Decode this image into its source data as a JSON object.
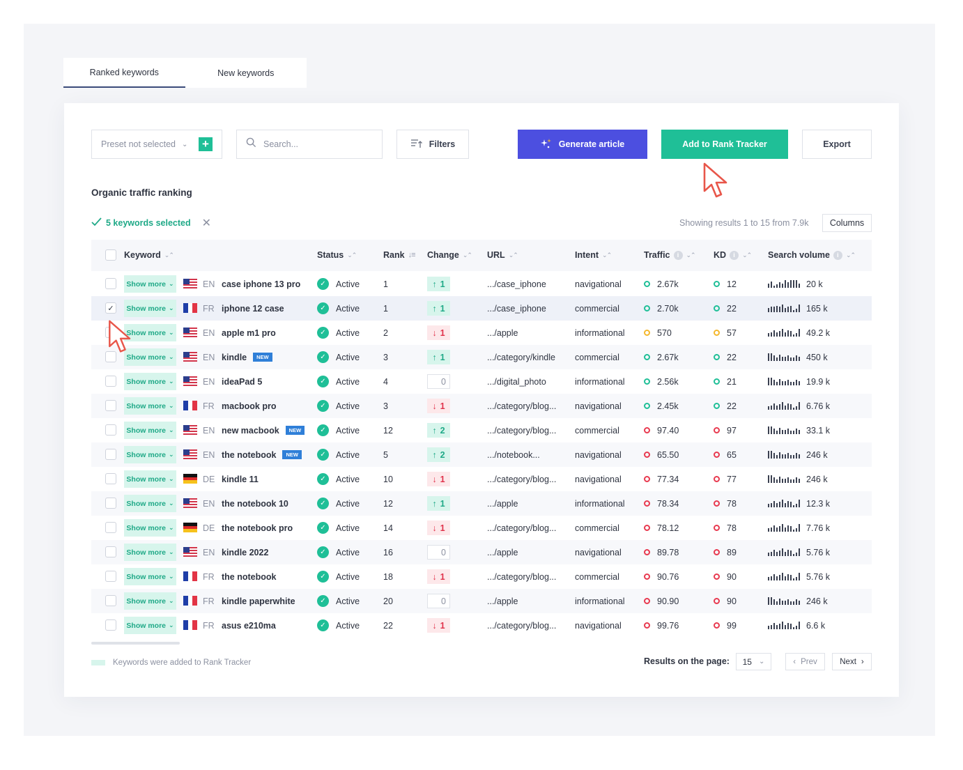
{
  "tabs": [
    {
      "label": "Ranked keywords",
      "active": true
    },
    {
      "label": "New keywords",
      "active": false
    }
  ],
  "toolbar": {
    "preset_label": "Preset not selected",
    "search_placeholder": "Search...",
    "filters_label": "Filters",
    "generate_label": "Generate article",
    "add_tracker_label": "Add to Rank Tracker",
    "export_label": "Export"
  },
  "section_title": "Organic traffic ranking",
  "selection": {
    "label": "5 keywords selected"
  },
  "showing_text": "Showing results 1 to 15 from 7.9k",
  "columns_label": "Columns",
  "headers": {
    "keyword": "Keyword",
    "status": "Status",
    "rank": "Rank",
    "change": "Change",
    "url": "URL",
    "intent": "Intent",
    "traffic": "Traffic",
    "kd": "KD",
    "search_volume": "Search volume"
  },
  "show_more_label": "Show more",
  "new_badge": "NEW",
  "rows": [
    {
      "checked": false,
      "country": "us",
      "lang": "EN",
      "keyword": "case iphone 13 pro",
      "new": false,
      "status": "Active",
      "rank": "1",
      "change_dir": "up",
      "change": "1",
      "url": ".../case_iphone",
      "intent": "navigational",
      "level": "green",
      "traffic": "2.67k",
      "kd": "12",
      "spark": [
        4,
        6,
        2,
        3,
        5,
        4,
        7,
        5,
        7,
        7,
        7,
        4
      ],
      "volume": "20 k"
    },
    {
      "checked": true,
      "country": "fr",
      "lang": "FR",
      "keyword": "iphone 12 case",
      "new": false,
      "status": "Active",
      "rank": "1",
      "change_dir": "up",
      "change": "1",
      "url": ".../case_iphone",
      "intent": "commercial",
      "level": "green",
      "traffic": "2.70k",
      "kd": "22",
      "spark": [
        4,
        5,
        5,
        6,
        5,
        7,
        4,
        5,
        6,
        2,
        3,
        7
      ],
      "volume": "165 k"
    },
    {
      "checked": false,
      "country": "us",
      "lang": "EN",
      "keyword": "apple m1 pro",
      "new": false,
      "status": "Active",
      "rank": "2",
      "change_dir": "down",
      "change": "1",
      "url": ".../apple",
      "intent": "informational",
      "level": "yellow",
      "traffic": "570",
      "kd": "57",
      "spark": [
        3,
        4,
        6,
        4,
        5,
        7,
        4,
        6,
        5,
        2,
        3,
        7
      ],
      "volume": "49.2 k"
    },
    {
      "checked": false,
      "country": "us",
      "lang": "EN",
      "keyword": "kindle",
      "new": true,
      "status": "Active",
      "rank": "3",
      "change_dir": "up",
      "change": "1",
      "url": ".../category/kindle",
      "intent": "commercial",
      "level": "green",
      "traffic": "2.67k",
      "kd": "22",
      "spark": [
        7,
        7,
        5,
        3,
        6,
        4,
        4,
        5,
        3,
        3,
        5,
        4
      ],
      "volume": "450 k"
    },
    {
      "checked": false,
      "country": "us",
      "lang": "EN",
      "keyword": "ideaPad 5",
      "new": false,
      "status": "Active",
      "rank": "4",
      "change_dir": "zero",
      "change": "0",
      "url": ".../digital_photo",
      "intent": "informational",
      "level": "green",
      "traffic": "2.56k",
      "kd": "21",
      "spark": [
        7,
        7,
        5,
        3,
        6,
        4,
        4,
        5,
        3,
        3,
        5,
        4
      ],
      "volume": "19.9 k"
    },
    {
      "checked": false,
      "country": "fr",
      "lang": "FR",
      "keyword": "macbook pro",
      "new": false,
      "status": "Active",
      "rank": "3",
      "change_dir": "down",
      "change": "1",
      "url": ".../category/blog...",
      "intent": "navigational",
      "level": "green",
      "traffic": "2.45k",
      "kd": "22",
      "spark": [
        3,
        4,
        6,
        4,
        5,
        7,
        4,
        6,
        5,
        2,
        3,
        7
      ],
      "volume": "6.76 k"
    },
    {
      "checked": false,
      "country": "us",
      "lang": "EN",
      "keyword": "new macbook",
      "new": true,
      "status": "Active",
      "rank": "12",
      "change_dir": "up",
      "change": "2",
      "url": ".../category/blog...",
      "intent": "commercial",
      "level": "red",
      "traffic": "97.40",
      "kd": "97",
      "spark": [
        7,
        7,
        5,
        3,
        6,
        4,
        4,
        5,
        3,
        3,
        5,
        4
      ],
      "volume": "33.1 k"
    },
    {
      "checked": false,
      "country": "us",
      "lang": "EN",
      "keyword": "the notebook",
      "new": true,
      "status": "Active",
      "rank": "5",
      "change_dir": "up",
      "change": "2",
      "url": ".../notebook...",
      "intent": "navigational",
      "level": "red",
      "traffic": "65.50",
      "kd": "65",
      "spark": [
        7,
        7,
        5,
        3,
        6,
        4,
        4,
        5,
        3,
        3,
        5,
        4
      ],
      "volume": "246 k"
    },
    {
      "checked": false,
      "country": "de",
      "lang": "DE",
      "keyword": "kindle 11",
      "new": false,
      "status": "Active",
      "rank": "10",
      "change_dir": "down",
      "change": "1",
      "url": ".../category/blog...",
      "intent": "navigational",
      "level": "red",
      "traffic": "77.34",
      "kd": "77",
      "spark": [
        7,
        7,
        5,
        3,
        6,
        4,
        4,
        5,
        3,
        3,
        5,
        4
      ],
      "volume": "246 k"
    },
    {
      "checked": false,
      "country": "us",
      "lang": "EN",
      "keyword": "the notebook 10",
      "new": false,
      "status": "Active",
      "rank": "12",
      "change_dir": "up",
      "change": "1",
      "url": ".../apple",
      "intent": "informational",
      "level": "red",
      "traffic": "78.34",
      "kd": "78",
      "spark": [
        3,
        4,
        6,
        4,
        5,
        7,
        4,
        6,
        5,
        2,
        3,
        7
      ],
      "volume": "12.3 k"
    },
    {
      "checked": false,
      "country": "de",
      "lang": "DE",
      "keyword": "the notebook pro",
      "new": false,
      "status": "Active",
      "rank": "14",
      "change_dir": "down",
      "change": "1",
      "url": ".../category/blog...",
      "intent": "commercial",
      "level": "red",
      "traffic": "78.12",
      "kd": "78",
      "spark": [
        3,
        4,
        6,
        4,
        5,
        7,
        4,
        6,
        5,
        2,
        3,
        7
      ],
      "volume": "7.76 k"
    },
    {
      "checked": false,
      "country": "us",
      "lang": "EN",
      "keyword": "kindle 2022",
      "new": false,
      "status": "Active",
      "rank": "16",
      "change_dir": "zero",
      "change": "0",
      "url": ".../apple",
      "intent": "navigational",
      "level": "red",
      "traffic": "89.78",
      "kd": "89",
      "spark": [
        3,
        4,
        6,
        4,
        5,
        7,
        4,
        6,
        5,
        2,
        3,
        7
      ],
      "volume": "5.76 k"
    },
    {
      "checked": false,
      "country": "fr",
      "lang": "FR",
      "keyword": "the notebook",
      "new": false,
      "status": "Active",
      "rank": "18",
      "change_dir": "down",
      "change": "1",
      "url": ".../category/blog...",
      "intent": "commercial",
      "level": "red",
      "traffic": "90.76",
      "kd": "90",
      "spark": [
        3,
        4,
        6,
        4,
        5,
        7,
        4,
        6,
        5,
        2,
        3,
        7
      ],
      "volume": "5.76 k"
    },
    {
      "checked": false,
      "country": "fr",
      "lang": "FR",
      "keyword": "kindle paperwhite",
      "new": false,
      "status": "Active",
      "rank": "20",
      "change_dir": "zero",
      "change": "0",
      "url": ".../apple",
      "intent": "informational",
      "level": "red",
      "traffic": "90.90",
      "kd": "90",
      "spark": [
        7,
        7,
        5,
        3,
        6,
        4,
        4,
        5,
        3,
        3,
        5,
        4
      ],
      "volume": "246 k"
    },
    {
      "checked": false,
      "country": "fr",
      "lang": "FR",
      "keyword": "asus e210ma",
      "new": false,
      "status": "Active",
      "rank": "22",
      "change_dir": "down",
      "change": "1",
      "url": ".../category/blog...",
      "intent": "navigational",
      "level": "red",
      "traffic": "99.76",
      "kd": "99",
      "spark": [
        3,
        4,
        6,
        4,
        5,
        7,
        4,
        6,
        5,
        2,
        3,
        7
      ],
      "volume": "6.6 k"
    }
  ],
  "legend_text": "Keywords were added to Rank Tracker",
  "pagination": {
    "label": "Results on the page:",
    "per_page": "15",
    "prev": "Prev",
    "next": "Next"
  },
  "colors": {
    "accent_green": "#1fbf97",
    "accent_purple": "#4c4fe0",
    "level_green": "#1fbf97",
    "level_yellow": "#f5b82e",
    "level_red": "#e8394f",
    "cursor_red": "#e8564a"
  }
}
